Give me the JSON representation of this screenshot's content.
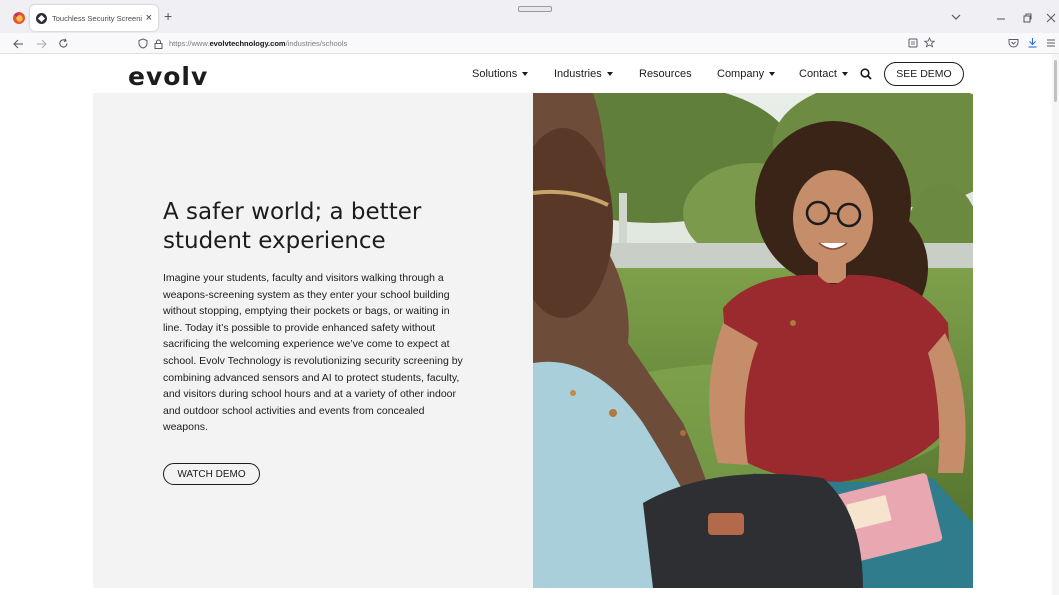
{
  "browser": {
    "tab_title": "Touchless Security Screening fo",
    "tab_close": "×",
    "new_tab": "+",
    "url_prefix": "https://www.",
    "url_domain": "evolvtechnology.com",
    "url_path": "/industries/schools",
    "icons": [
      "firefox-icon",
      "back-arrow-icon",
      "forward-arrow-icon",
      "reload-icon",
      "shield-icon",
      "lock-icon",
      "reader-view-icon",
      "bookmark-star-icon",
      "pocket-icon",
      "download-icon",
      "hamburger-menu-icon",
      "minimize-icon",
      "maximize-icon",
      "close-window-icon"
    ]
  },
  "header": {
    "logo": "evolv",
    "nav": [
      {
        "label": "Solutions",
        "dropdown": true
      },
      {
        "label": "Industries",
        "dropdown": true
      },
      {
        "label": "Resources",
        "dropdown": false
      },
      {
        "label": "Company",
        "dropdown": true
      },
      {
        "label": "Contact",
        "dropdown": true
      }
    ],
    "see_demo": "SEE DEMO"
  },
  "hero": {
    "title_line1": "A safer world; a better",
    "title_line2": "student experience",
    "body": "Imagine your students, faculty and visitors walking through a weapons-screening system as they enter your school building without stopping, emptying their pockets or bags, or waiting in line. Today it’s possible to provide enhanced safety without sacrificing the welcoming experience we’ve come to expect at school. Evolv Technology is revolutionizing security screening by combining advanced sensors and AI to protect students, faculty, and visitors during school hours and at a variety of other indoor and outdoor school activities and events from concealed weapons.",
    "watch_demo": "WATCH DEMO"
  },
  "colors": {
    "text": "#1c1c1c",
    "hero_bg": "#f3f3f3",
    "chrome_bg": "#f0f0f4"
  }
}
